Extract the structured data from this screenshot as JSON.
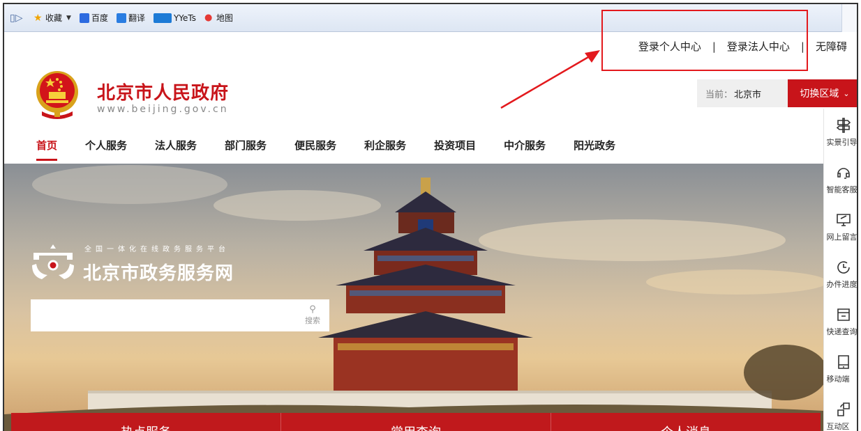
{
  "bookmarks": {
    "items": [
      {
        "label": "收藏",
        "icon": "star-icon"
      },
      {
        "label": "百度",
        "icon": "baidu-paw-icon"
      },
      {
        "label": "翻译",
        "icon": "translate-icon"
      },
      {
        "label": "YYeTs",
        "icon": "yyets-icon"
      },
      {
        "label": "地图",
        "icon": "map-pin-icon"
      }
    ]
  },
  "top_links": {
    "personal": "登录个人中心",
    "separator": "|",
    "legal": "登录法人中心",
    "accessible": "无障碍"
  },
  "header": {
    "title": "北京市人民政府",
    "url": "www.beijing.gov.cn"
  },
  "region": {
    "current_prefix": "当前：",
    "current_value": "北京市",
    "switch_label": "切换区域"
  },
  "nav": {
    "items": [
      "首页",
      "个人服务",
      "法人服务",
      "部门服务",
      "便民服务",
      "利企服务",
      "投资项目",
      "中介服务",
      "阳光政务"
    ],
    "active_index": 0
  },
  "portal": {
    "subtitle": "全国一体化在线政务服务平台",
    "title": "北京市政务服务网"
  },
  "search": {
    "value": "",
    "button_label": "搜索"
  },
  "bottom_bar": {
    "items": [
      "热点服务",
      "常用查询",
      "个人消息"
    ]
  },
  "side_tools": {
    "items": [
      {
        "label": "实景引导",
        "icon": "signpost-icon"
      },
      {
        "label": "智能客服",
        "icon": "headset-icon"
      },
      {
        "label": "网上留言",
        "icon": "message-monitor-icon"
      },
      {
        "label": "办件进度",
        "icon": "progress-clock-icon"
      },
      {
        "label": "快递查询",
        "icon": "express-box-icon"
      },
      {
        "label": "移动端",
        "icon": "mobile-icon"
      },
      {
        "label": "互动区",
        "icon": "interaction-icon"
      }
    ]
  },
  "colors": {
    "brand_red": "#c8141a",
    "annotation_red": "#e3191d"
  }
}
